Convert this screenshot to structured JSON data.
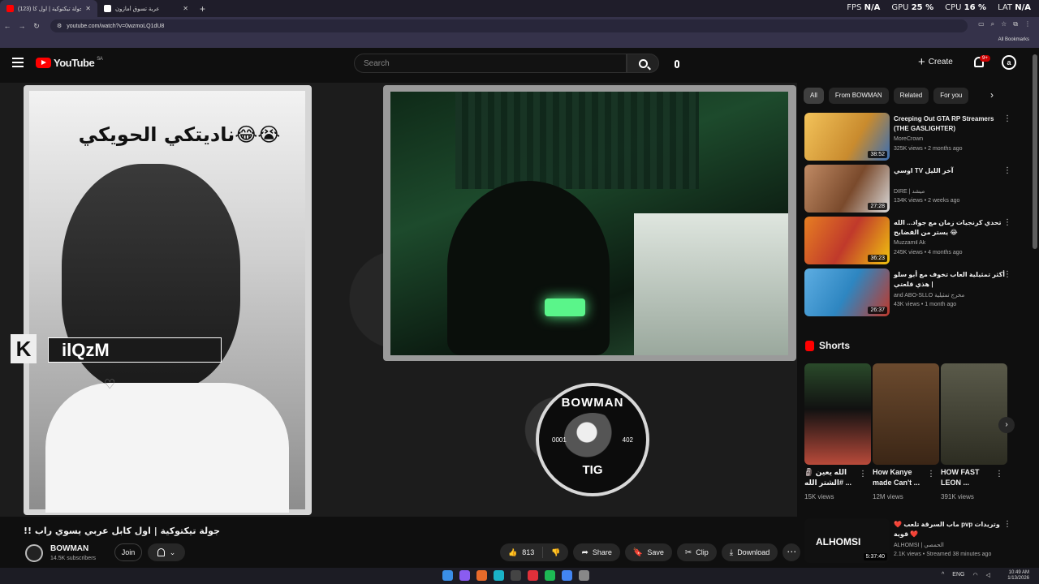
{
  "browser": {
    "tabs": [
      {
        "title": "(123) جولة تيكتوكية | اول كا…",
        "active": true
      },
      {
        "title": "عربة تسوق أمازون",
        "active": false
      }
    ],
    "url": "youtube.com/watch?v=0wzmoLQ1dU8",
    "bookmarks_label": "All Bookmarks"
  },
  "overlay_stats": {
    "fps_label": "FPS",
    "fps_value": "N/A",
    "gpu_label": "GPU",
    "gpu_value": "25 %",
    "cpu_label": "CPU",
    "cpu_value": "16 %",
    "lat_label": "LAT",
    "lat_value": "N/A"
  },
  "youtube": {
    "logo_text": "YouTube",
    "logo_region": "SA",
    "search_placeholder": "Search",
    "create_label": "Create",
    "notifications_badge": "9+",
    "avatar_letter": "a"
  },
  "video": {
    "overlay_caption": "ناديتكي الحويكي😂😭",
    "name_tag": "ilQzM",
    "k_logo": "K",
    "emblem_top": "BOWMAN",
    "emblem_bottom": "TIG",
    "emblem_left": "0001",
    "emblem_right": "402",
    "title": "!! جولة تيكتوكية | اول كابل عربي يسوي راب",
    "channel_name": "BOWMAN",
    "subscribers": "14.5K subscribers",
    "join_label": "Join",
    "likes": "813",
    "share_label": "Share",
    "save_label": "Save",
    "clip_label": "Clip",
    "download_label": "Download"
  },
  "chips": [
    "All",
    "From BOWMAN",
    "Related",
    "For you"
  ],
  "recommendations": [
    {
      "title": "Creeping Out GTA RP Streamers (THE GASLIGHTER)",
      "channel": "MoreCrown",
      "meta": "325K views • 2 months ago",
      "duration": "38:52",
      "color": "#e9a13b"
    },
    {
      "title": "اوسي TV آخر الليل",
      "channel": "DIRE | ميشد",
      "meta": "134K views • 2 weeks ago",
      "duration": "27:28",
      "color": "#a0522d"
    },
    {
      "title": "تحدي كرنجيات زمان مع جواد... الله يستر من الفضايح 😂",
      "channel": "Muzzamil Ak",
      "meta": "245K views • 4 months ago",
      "duration": "36:23",
      "color": "#c0392b"
    },
    {
      "title": "أكثر تمثيلية العاب تخوف مع أبو سلو | هذي قلعتي",
      "channel": "and ABO-SLLO مخرج تمثيلية",
      "meta": "43K views • 1 month ago",
      "duration": "26:37",
      "color": "#2e86c1"
    }
  ],
  "shorts_heading": "Shorts",
  "shorts": [
    {
      "title": "🗿 الله يعين #الشتر الله ...",
      "views": "15K views",
      "color": "#7a3b2e"
    },
    {
      "title": "How Kanye made Can't ...",
      "views": "12M views",
      "color": "#5a3a22"
    },
    {
      "title": "HOW FAST LEON ...",
      "views": "391K views",
      "color": "#4a4a3a"
    }
  ],
  "last_recommendation": {
    "thumb_label": "ALHOMSI",
    "title": "❤️ ماب السرقة تلعب pvp وتريدات قوية ❤️",
    "channel": "ALHOMSI | الحمصي",
    "meta": "2.1K views • Streamed 38 minutes ago",
    "duration": "5:37:40"
  },
  "taskbar": {
    "lang": "ENG",
    "time": "10:49 AM",
    "date": "1/13/2026"
  }
}
